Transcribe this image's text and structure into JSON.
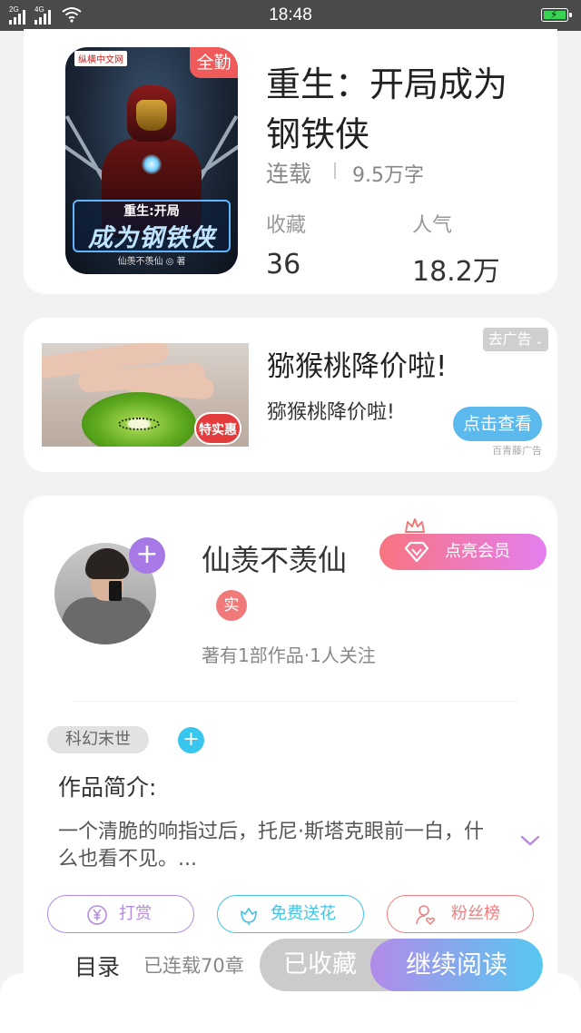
{
  "status_bar": {
    "time": "18:48",
    "signal1_label": "2G",
    "signal2_label": "4G",
    "battery_icon": "battery-charging-icon",
    "wifi_icon": "wifi-icon"
  },
  "book": {
    "title": "重生：开局成为钢铁侠",
    "status": "连载",
    "word_count": "9.5万字",
    "badge": "全勤",
    "cover": {
      "publisher": "纵横中文网",
      "title_top": "重生:开局",
      "title_main": "成为钢铁侠",
      "author_line": "仙羡不羡仙 ◎ 著"
    },
    "stats": [
      {
        "label": "收藏",
        "value": "36"
      },
      {
        "label": "人气",
        "value": "18.2万"
      }
    ]
  },
  "ad": {
    "title": "猕猴桃降价啦!",
    "description": "猕猴桃降价啦!",
    "close_label": "去广告",
    "cta_label": "点击查看",
    "source": "百青藤广告",
    "image_sticker": "特实惠"
  },
  "author": {
    "name": "仙羡不羡仙",
    "real_badge": "实",
    "meta": "著有1部作品·1人关注",
    "vip_label": "点亮会员"
  },
  "work": {
    "genre_tag": "科幻末世",
    "intro_title": "作品简介:",
    "intro_text": "一个清脆的响指过后，托尼·斯塔克眼前一白，什么也看不见。...",
    "actions": [
      {
        "label": "打赏",
        "icon": "yuan-icon",
        "color": "#b48be0"
      },
      {
        "label": "免费送花",
        "icon": "flower-icon",
        "color": "#44c3e6"
      },
      {
        "label": "粉丝榜",
        "icon": "user-heart-icon",
        "color": "#ef7f7f"
      }
    ]
  },
  "bottom_bar": {
    "toc_label": "目录",
    "chapter_count": "已连载70章",
    "collected_label": "已收藏",
    "read_label": "继续阅读"
  },
  "colors": {
    "accent_purple": "#a779e6",
    "accent_blue": "#56c7f0",
    "accent_red": "#ef5a5a"
  }
}
